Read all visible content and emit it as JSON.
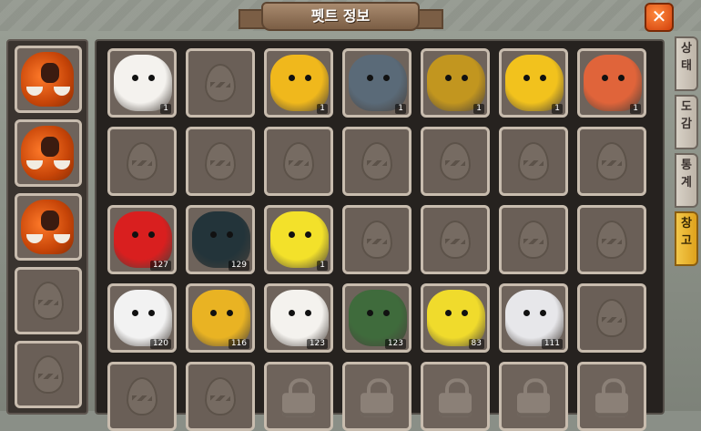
{
  "title": "펫트 정보",
  "close_icon": "close-icon",
  "side_tabs": [
    {
      "label": "상태",
      "active": false
    },
    {
      "label": "도감",
      "active": false
    },
    {
      "label": "통계",
      "active": false
    },
    {
      "label": "창고",
      "active": true
    }
  ],
  "left_slots": [
    {
      "type": "mammoth"
    },
    {
      "type": "mammoth"
    },
    {
      "type": "mammoth"
    },
    {
      "type": "empty"
    },
    {
      "type": "empty"
    }
  ],
  "grid": [
    [
      {
        "type": "pet",
        "name": "pig",
        "color": "#f4f2ee",
        "count": "1"
      },
      {
        "type": "empty"
      },
      {
        "type": "pet",
        "name": "yellow-boar",
        "color": "#f0b81c",
        "count": "1"
      },
      {
        "type": "pet",
        "name": "dark-dragon",
        "color": "#5a6a78",
        "count": "1"
      },
      {
        "type": "pet",
        "name": "leaf-bird",
        "color": "#c2961f",
        "count": "1"
      },
      {
        "type": "pet",
        "name": "red-lion",
        "color": "#f2c21d",
        "count": "1"
      },
      {
        "type": "pet",
        "name": "orange-lizard",
        "color": "#e0643a",
        "count": "1"
      }
    ],
    [
      {
        "type": "empty"
      },
      {
        "type": "empty"
      },
      {
        "type": "empty"
      },
      {
        "type": "empty"
      },
      {
        "type": "empty"
      },
      {
        "type": "empty"
      },
      {
        "type": "empty"
      }
    ],
    [
      {
        "type": "pet",
        "name": "red-dragon",
        "color": "#d91f1f",
        "count": "127"
      },
      {
        "type": "pet",
        "name": "black-dragon",
        "color": "#23343a",
        "count": "129"
      },
      {
        "type": "pet",
        "name": "yellow-dragon",
        "color": "#f3e12a",
        "count": "1"
      },
      {
        "type": "empty"
      },
      {
        "type": "empty"
      },
      {
        "type": "empty"
      },
      {
        "type": "empty"
      }
    ],
    [
      {
        "type": "pet",
        "name": "white-tiger",
        "color": "#f2f2f2",
        "count": "120"
      },
      {
        "type": "pet",
        "name": "yellow-sabertooth",
        "color": "#e9b323",
        "count": "116"
      },
      {
        "type": "pet",
        "name": "pig",
        "color": "#f4f2ee",
        "count": "123"
      },
      {
        "type": "pet",
        "name": "green-dino",
        "color": "#3f6b3c",
        "count": "123"
      },
      {
        "type": "pet",
        "name": "yellow-serpent",
        "color": "#f0db2c",
        "count": "83"
      },
      {
        "type": "pet",
        "name": "black-white-tiger",
        "color": "#e7e7ea",
        "count": "111"
      },
      {
        "type": "empty"
      }
    ],
    [
      {
        "type": "empty"
      },
      {
        "type": "empty"
      },
      {
        "type": "lock"
      },
      {
        "type": "lock"
      },
      {
        "type": "lock"
      },
      {
        "type": "lock"
      },
      {
        "type": "lock"
      }
    ]
  ]
}
